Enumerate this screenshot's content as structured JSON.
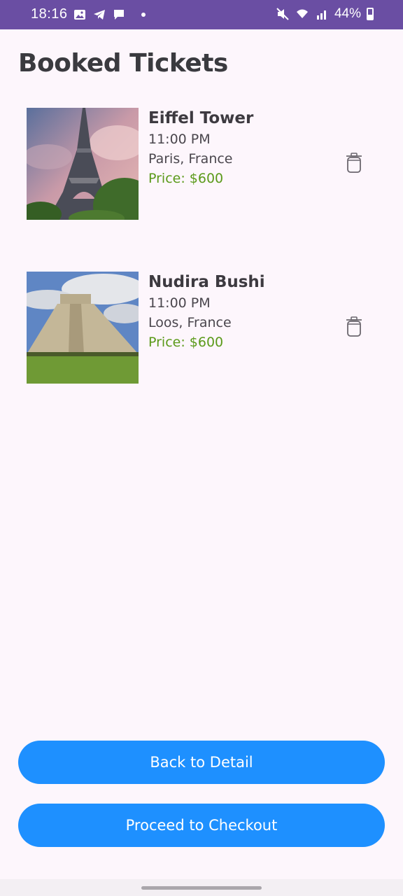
{
  "status_bar": {
    "time": "18:16",
    "left_icons": [
      "image-icon",
      "telegram-icon",
      "message-icon"
    ],
    "right_icons": [
      "mute-icon",
      "wifi-icon",
      "signal-icon"
    ],
    "battery": "44%"
  },
  "page": {
    "title": "Booked Tickets"
  },
  "tickets": [
    {
      "name": "Eiffel Tower",
      "time": "11:00 PM",
      "location": "Paris, France",
      "price": "Price: $600"
    },
    {
      "name": "Nudira Bushi",
      "time": "11:00 PM",
      "location": "Loos, France",
      "price": "Price: $600"
    }
  ],
  "buttons": {
    "back": "Back to Detail",
    "checkout": "Proceed to Checkout"
  },
  "colors": {
    "status_bar": "#6a4ea3",
    "primary_button": "#1e90ff",
    "price": "#5b9a1a",
    "background": "#fdf6fc"
  }
}
